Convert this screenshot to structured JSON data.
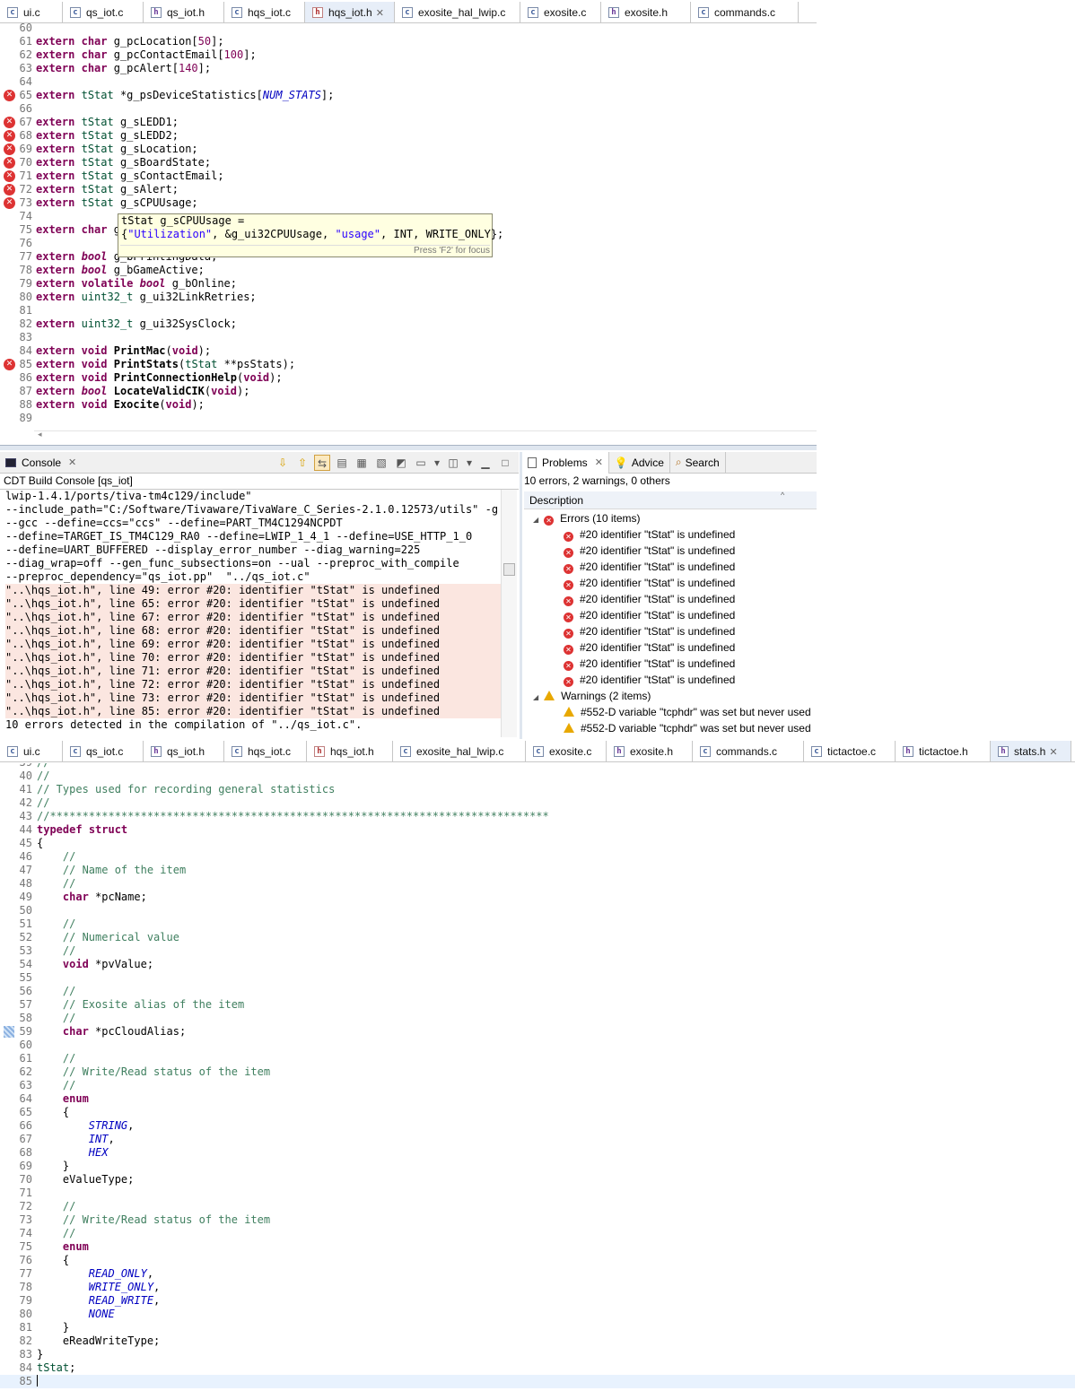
{
  "top_tabs": [
    {
      "label": "ui.c",
      "icon": "c-file-icon",
      "active": false
    },
    {
      "label": "qs_iot.c",
      "icon": "c-file-icon",
      "active": false
    },
    {
      "label": "qs_iot.h",
      "icon": "h-file-icon",
      "active": false
    },
    {
      "label": "hqs_iot.c",
      "icon": "c-file-icon",
      "active": false
    },
    {
      "label": "hqs_iot.h",
      "icon": "h-file-error-icon",
      "active": true
    },
    {
      "label": "exosite_hal_lwip.c",
      "icon": "c-file-icon",
      "active": false
    },
    {
      "label": "exosite.c",
      "icon": "c-file-icon",
      "active": false
    },
    {
      "label": "exosite.h",
      "icon": "h-file-icon",
      "active": false
    },
    {
      "label": "commands.c",
      "icon": "c-file-icon",
      "active": false
    }
  ],
  "editor1": {
    "lines": [
      {
        "n": "60",
        "html": "",
        "err": false
      },
      {
        "n": "61",
        "html": "<span class='kw'>extern</span> <span class='kw'>char</span> g_pcLocation[<span class='nm'>50</span>];",
        "err": false
      },
      {
        "n": "62",
        "html": "<span class='kw'>extern</span> <span class='kw'>char</span> g_pcContactEmail[<span class='nm'>100</span>];",
        "err": false
      },
      {
        "n": "63",
        "html": "<span class='kw'>extern</span> <span class='kw'>char</span> g_pcAlert[<span class='nm'>140</span>];",
        "err": false
      },
      {
        "n": "64",
        "html": "",
        "err": false
      },
      {
        "n": "65",
        "html": "<span class='kw'>extern</span> <span class='ty'>tStat</span> *g_psDeviceStatistics[<span class='ev'>NUM_STATS</span>];",
        "err": true
      },
      {
        "n": "66",
        "html": "",
        "err": false
      },
      {
        "n": "67",
        "html": "<span class='kw'>extern</span> <span class='ty'>tStat</span> g_sLEDD1;",
        "err": true
      },
      {
        "n": "68",
        "html": "<span class='kw'>extern</span> <span class='ty'>tStat</span> g_sLEDD2;",
        "err": true
      },
      {
        "n": "69",
        "html": "<span class='kw'>extern</span> <span class='ty'>tStat</span> g_sLocation;",
        "err": true
      },
      {
        "n": "70",
        "html": "<span class='kw'>extern</span> <span class='ty'>tStat</span> g_sBoardState;",
        "err": true
      },
      {
        "n": "71",
        "html": "<span class='kw'>extern</span> <span class='ty'>tStat</span> g_sContactEmail;",
        "err": true
      },
      {
        "n": "72",
        "html": "<span class='kw'>extern</span> <span class='ty'>tStat</span> g_sAlert;",
        "err": true
      },
      {
        "n": "73",
        "html": "<span class='kw'>extern</span> <span class='ty'>tStat</span> g_sCPUUsage;",
        "err": true
      },
      {
        "n": "74",
        "html": "",
        "err": false
      },
      {
        "n": "75",
        "html": "<span class='kw'>extern</span> <span class='kw'>char</span> g",
        "err": false
      },
      {
        "n": "76",
        "html": "",
        "err": false
      },
      {
        "n": "77",
        "html": "<span class='kw'>extern</span> <span class='tb'>bool</span> g_bPrintingData;",
        "err": false
      },
      {
        "n": "78",
        "html": "<span class='kw'>extern</span> <span class='tb'>bool</span> g_bGameActive;",
        "err": false
      },
      {
        "n": "79",
        "html": "<span class='kw'>extern</span> <span class='kw'>volatile</span> <span class='tb'>bool</span> g_bOnline;",
        "err": false
      },
      {
        "n": "80",
        "html": "<span class='kw'>extern</span> <span class='ty'>uint32_t</span> g_ui32LinkRetries;",
        "err": false
      },
      {
        "n": "81",
        "html": "",
        "err": false
      },
      {
        "n": "82",
        "html": "<span class='kw'>extern</span> <span class='ty'>uint32_t</span> g_ui32SysClock;",
        "err": false
      },
      {
        "n": "83",
        "html": "",
        "err": false
      },
      {
        "n": "84",
        "html": "<span class='kw'>extern</span> <span class='kw'>void</span> <span class='fn'>PrintMac</span>(<span class='kw'>void</span>);",
        "err": false
      },
      {
        "n": "85",
        "html": "<span class='kw'>extern</span> <span class='kw'>void</span> <span class='fn'>PrintStats</span>(<span class='ty'>tStat</span> **psStats);",
        "err": true
      },
      {
        "n": "86",
        "html": "<span class='kw'>extern</span> <span class='kw'>void</span> <span class='fn'>PrintConnectionHelp</span>(<span class='kw'>void</span>);",
        "err": false
      },
      {
        "n": "87",
        "html": "<span class='kw'>extern</span> <span class='tb'>bool</span> <span class='fn'>LocateValidCIK</span>(<span class='kw'>void</span>);",
        "err": false
      },
      {
        "n": "88",
        "html": "<span class='kw'>extern</span> <span class='kw'>void</span> <span class='fn'>Exocite</span>(<span class='kw'>void</span>);",
        "err": false
      },
      {
        "n": "89",
        "html": "",
        "err": false
      }
    ]
  },
  "tooltip": {
    "line1": "tStat g_sCPUUsage =",
    "line2": "{\"Utilization\", &g_ui32CPUUsage, \"usage\", INT, WRITE_ONLY};",
    "hint": "Press 'F2' for focus"
  },
  "console": {
    "title": "Console",
    "subtitle": "CDT Build Console [qs_iot]",
    "lines": [
      {
        "t": "lwip-1.4.1/ports/tiva-tm4c129/include\"",
        "e": false
      },
      {
        "t": "--include_path=\"C:/Software/Tivaware/TivaWare_C_Series-2.1.0.12573/utils\" -g",
        "e": false
      },
      {
        "t": "--gcc --define=ccs=\"ccs\" --define=PART_TM4C1294NCPDT",
        "e": false
      },
      {
        "t": "--define=TARGET_IS_TM4C129_RA0 --define=LWIP_1_4_1 --define=USE_HTTP_1_0",
        "e": false
      },
      {
        "t": "--define=UART_BUFFERED --display_error_number --diag_warning=225",
        "e": false
      },
      {
        "t": "--diag_wrap=off --gen_func_subsections=on --ual --preproc_with_compile",
        "e": false
      },
      {
        "t": "--preproc_dependency=\"qs_iot.pp\"  \"../qs_iot.c\"",
        "e": false
      },
      {
        "t": "\"..\\hqs_iot.h\", line 49: error #20: identifier \"tStat\" is undefined",
        "e": true
      },
      {
        "t": "\"..\\hqs_iot.h\", line 65: error #20: identifier \"tStat\" is undefined",
        "e": true
      },
      {
        "t": "\"..\\hqs_iot.h\", line 67: error #20: identifier \"tStat\" is undefined",
        "e": true
      },
      {
        "t": "\"..\\hqs_iot.h\", line 68: error #20: identifier \"tStat\" is undefined",
        "e": true
      },
      {
        "t": "\"..\\hqs_iot.h\", line 69: error #20: identifier \"tStat\" is undefined",
        "e": true
      },
      {
        "t": "\"..\\hqs_iot.h\", line 70: error #20: identifier \"tStat\" is undefined",
        "e": true
      },
      {
        "t": "\"..\\hqs_iot.h\", line 71: error #20: identifier \"tStat\" is undefined",
        "e": true
      },
      {
        "t": "\"..\\hqs_iot.h\", line 72: error #20: identifier \"tStat\" is undefined",
        "e": true
      },
      {
        "t": "\"..\\hqs_iot.h\", line 73: error #20: identifier \"tStat\" is undefined",
        "e": true
      },
      {
        "t": "\"..\\hqs_iot.h\", line 85: error #20: identifier \"tStat\" is undefined",
        "e": true
      },
      {
        "t": "10 errors detected in the compilation of \"../qs_iot.c\".",
        "e": false
      }
    ]
  },
  "problems": {
    "tabs": [
      "Problems",
      "Advice",
      "Search"
    ],
    "summary": "10 errors, 2 warnings, 0 others",
    "column": "Description",
    "errors_group": "Errors (10 items)",
    "errors": [
      "#20 identifier \"tStat\" is undefined",
      "#20 identifier \"tStat\" is undefined",
      "#20 identifier \"tStat\" is undefined",
      "#20 identifier \"tStat\" is undefined",
      "#20 identifier \"tStat\" is undefined",
      "#20 identifier \"tStat\" is undefined",
      "#20 identifier \"tStat\" is undefined",
      "#20 identifier \"tStat\" is undefined",
      "#20 identifier \"tStat\" is undefined",
      "#20 identifier \"tStat\" is undefined"
    ],
    "warnings_group": "Warnings (2 items)",
    "warnings": [
      "#552-D variable \"tcphdr\" was set but never used",
      "#552-D variable \"tcphdr\" was set but never used"
    ]
  },
  "bottom_tabs": [
    {
      "label": "ui.c",
      "icon": "c-file-icon",
      "active": false
    },
    {
      "label": "qs_iot.c",
      "icon": "c-file-icon",
      "active": false
    },
    {
      "label": "qs_iot.h",
      "icon": "h-file-icon",
      "active": false
    },
    {
      "label": "hqs_iot.c",
      "icon": "c-file-icon",
      "active": false
    },
    {
      "label": "hqs_iot.h",
      "icon": "h-file-error-icon",
      "active": false
    },
    {
      "label": "exosite_hal_lwip.c",
      "icon": "c-file-icon",
      "active": false
    },
    {
      "label": "exosite.c",
      "icon": "c-file-icon",
      "active": false
    },
    {
      "label": "exosite.h",
      "icon": "h-file-icon",
      "active": false
    },
    {
      "label": "commands.c",
      "icon": "c-file-icon",
      "active": false
    },
    {
      "label": "tictactoe.c",
      "icon": "c-file-icon",
      "active": false
    },
    {
      "label": "tictactoe.h",
      "icon": "h-file-icon",
      "active": false
    },
    {
      "label": "stats.h",
      "icon": "h-file-icon",
      "active": true
    }
  ],
  "editor2": {
    "lines": [
      {
        "n": "39",
        "html": "<span class='cm'>//</span>"
      },
      {
        "n": "40",
        "html": "<span class='cm'>//</span>"
      },
      {
        "n": "41",
        "html": "<span class='cm'>// Types used for recording general statistics</span>"
      },
      {
        "n": "42",
        "html": "<span class='cm'>//</span>"
      },
      {
        "n": "43",
        "html": "<span class='cm'>//*****************************************************************************</span>"
      },
      {
        "n": "44",
        "html": "<span class='kw'>typedef</span> <span class='kw'>struct</span>"
      },
      {
        "n": "45",
        "html": "{"
      },
      {
        "n": "46",
        "html": "    <span class='cm'>//</span>"
      },
      {
        "n": "47",
        "html": "    <span class='cm'>// Name of the item</span>"
      },
      {
        "n": "48",
        "html": "    <span class='cm'>//</span>"
      },
      {
        "n": "49",
        "html": "    <span class='kw'>char</span> *pcName;"
      },
      {
        "n": "50",
        "html": ""
      },
      {
        "n": "51",
        "html": "    <span class='cm'>//</span>"
      },
      {
        "n": "52",
        "html": "    <span class='cm'>// Numerical value</span>"
      },
      {
        "n": "53",
        "html": "    <span class='cm'>//</span>"
      },
      {
        "n": "54",
        "html": "    <span class='kw'>void</span> *pvValue;"
      },
      {
        "n": "55",
        "html": ""
      },
      {
        "n": "56",
        "html": "    <span class='cm'>//</span>"
      },
      {
        "n": "57",
        "html": "    <span class='cm'>// Exosite alias of the item</span>"
      },
      {
        "n": "58",
        "html": "    <span class='cm'>//</span>"
      },
      {
        "n": "59",
        "html": "    <span class='kw'>char</span> *pcCloudAlias;"
      },
      {
        "n": "60",
        "html": ""
      },
      {
        "n": "61",
        "html": "    <span class='cm'>//</span>"
      },
      {
        "n": "62",
        "html": "    <span class='cm'>// Write/Read status of the item</span>"
      },
      {
        "n": "63",
        "html": "    <span class='cm'>//</span>"
      },
      {
        "n": "64",
        "html": "    <span class='kw'>enum</span>"
      },
      {
        "n": "65",
        "html": "    {"
      },
      {
        "n": "66",
        "html": "        <span class='ev'>STRING</span>,"
      },
      {
        "n": "67",
        "html": "        <span class='ev'>INT</span>,"
      },
      {
        "n": "68",
        "html": "        <span class='ev'>HEX</span>"
      },
      {
        "n": "69",
        "html": "    }"
      },
      {
        "n": "70",
        "html": "    eValueType;"
      },
      {
        "n": "71",
        "html": ""
      },
      {
        "n": "72",
        "html": "    <span class='cm'>//</span>"
      },
      {
        "n": "73",
        "html": "    <span class='cm'>// Write/Read status of the item</span>"
      },
      {
        "n": "74",
        "html": "    <span class='cm'>//</span>"
      },
      {
        "n": "75",
        "html": "    <span class='kw'>enum</span>"
      },
      {
        "n": "76",
        "html": "    {"
      },
      {
        "n": "77",
        "html": "        <span class='ev'>READ_ONLY</span>,"
      },
      {
        "n": "78",
        "html": "        <span class='ev'>WRITE_ONLY</span>,"
      },
      {
        "n": "79",
        "html": "        <span class='ev'>READ_WRITE</span>,"
      },
      {
        "n": "80",
        "html": "        <span class='ev'>NONE</span>"
      },
      {
        "n": "81",
        "html": "    }"
      },
      {
        "n": "82",
        "html": "    eReadWriteType;"
      },
      {
        "n": "83",
        "html": "}"
      },
      {
        "n": "84",
        "html": "<span class='ty'>tStat</span>;"
      },
      {
        "n": "85",
        "html": "|"
      }
    ]
  }
}
